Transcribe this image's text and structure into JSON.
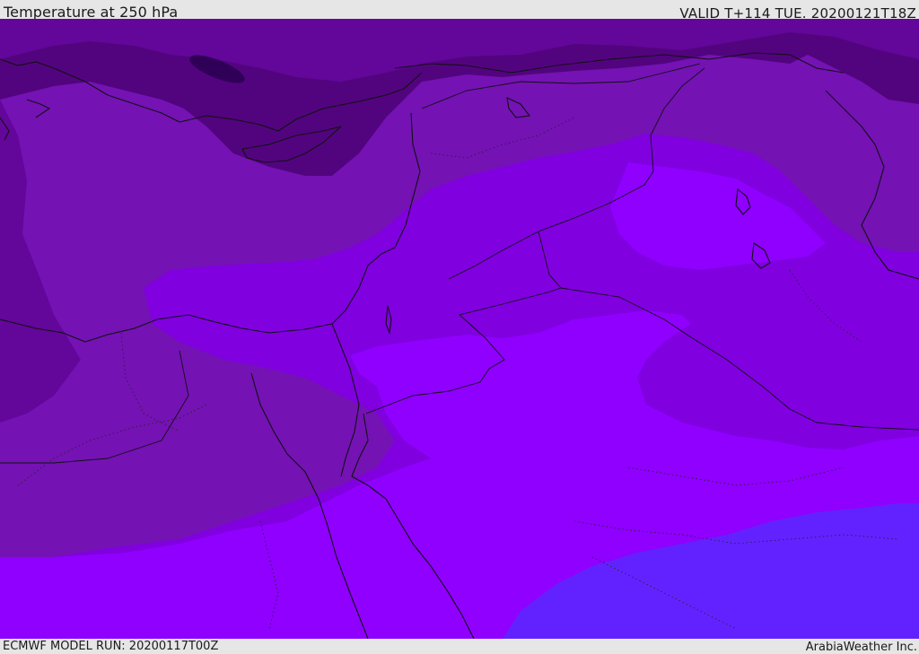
{
  "header": {
    "title": "Temperature at 250 hPa",
    "valid_time": "VALID T+114 TUE. 20200121T18Z"
  },
  "footer": {
    "model_run": "ECMWF MODEL RUN: 20200117T00Z",
    "credit": "ArabiaWeather Inc."
  },
  "colors": {
    "darkest": "#300058",
    "very_dark": "#52047e",
    "dark": "#63069a",
    "medium_dark": "#7412b4",
    "medium": "#8000e0",
    "bright": "#8f00ff",
    "blue_violet": "#6222ff",
    "outline": "#111111"
  }
}
